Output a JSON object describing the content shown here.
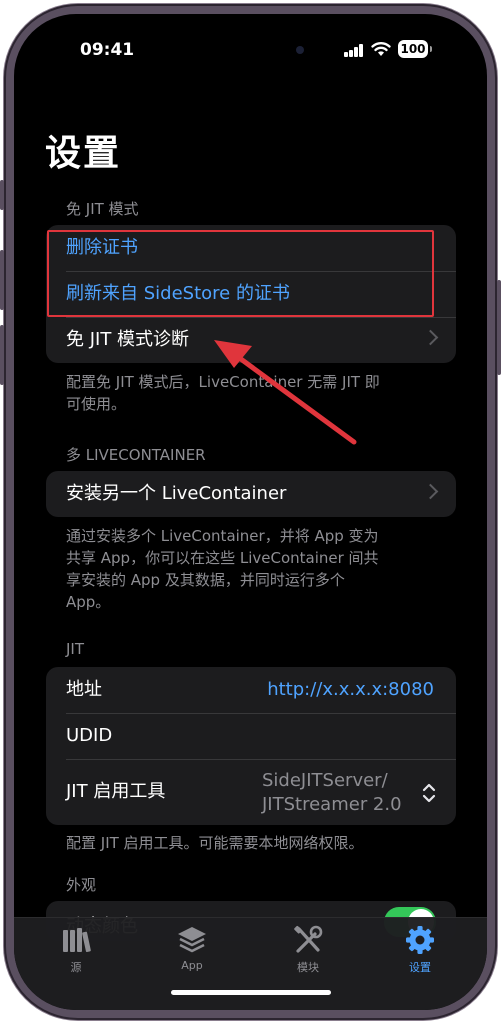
{
  "status": {
    "time": "09:41",
    "battery": "100"
  },
  "title": "设置",
  "sections": {
    "jitless": {
      "header": "免 JIT 模式",
      "delete_cert": "删除证书",
      "refresh_cert": "刷新来自 SideStore 的证书",
      "diagnose": "免 JIT 模式诊断",
      "footer_line1": "配置免 JIT 模式后，LiveContainer 无需 JIT 即",
      "footer_line2": "可使用。"
    },
    "multi": {
      "header": "多 LIVECONTAINER",
      "install": "安装另一个 LiveContainer",
      "footer_line1": "通过安装多个 LiveContainer，并将 App 变为",
      "footer_line2": "共享 App，你可以在这些 LiveContainer 间共",
      "footer_line3": "享安装的 App 及其数据，并同时运行多个",
      "footer_line4": "App。"
    },
    "jit": {
      "header": "JIT",
      "address_label": "地址",
      "address_value": "http://x.x.x.x:8080",
      "udid_label": "UDID",
      "tool_label": "JIT 启用工具",
      "tool_value_line1": "SideJITServer/",
      "tool_value_line2": "JITStreamer 2.0",
      "footer": "配置 JIT 启用工具。可能需要本地网络权限。"
    },
    "appearance": {
      "header": "外观",
      "partial_row": "动态颜色",
      "toggle_on": true
    }
  },
  "tabs": [
    {
      "label": "源",
      "icon": "library-icon"
    },
    {
      "label": "App",
      "icon": "stack-icon"
    },
    {
      "label": "模块",
      "icon": "tools-icon"
    },
    {
      "label": "设置",
      "icon": "gear-icon",
      "active": true
    }
  ],
  "colors": {
    "accent": "#4fa3ff",
    "highlight": "#e0353c",
    "toggle": "#34c759"
  }
}
